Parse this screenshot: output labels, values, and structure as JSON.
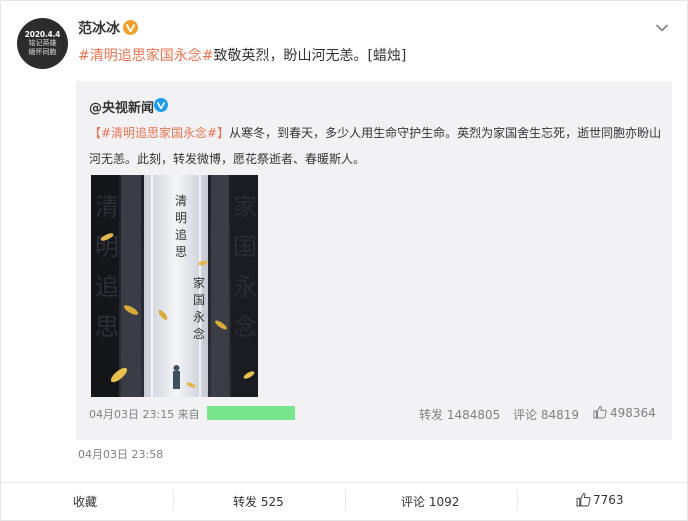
{
  "post": {
    "username": "范冰冰",
    "avatar": {
      "line1": "2020.4.4",
      "line2": "铭记英雄",
      "line3": "缅怀同胞"
    },
    "topic": "#清明追思家国永念#",
    "text": "致敬英烈，盼山河无恙。[蜡烛]",
    "time": "04月03日 23:58"
  },
  "repost": {
    "username": "@央视新闻",
    "topic": "【#清明追思家国永念#】",
    "text": "从寒冬，到春天，多少人用生命守护生命。英烈为家国舍生忘死，逝世同胞亦盼山河无恙。此刻，转发微博，愿花祭逝者、春暖斯人。",
    "poster_line1": "清明追思",
    "poster_line2": "家国永念",
    "time_source": "04月03日 23:15 来自",
    "reposts": "转发 1484805",
    "comments": "评论 84819",
    "likes": "498364"
  },
  "actions": {
    "favorite": "收藏",
    "repost": "转发 525",
    "comment": "评论 1092",
    "like": "7763"
  },
  "colors": {
    "topic": "#eb7350",
    "verified_orange": "#f0a12b",
    "verified_blue": "#1f9cf0",
    "source_redacted": "#79e58d"
  }
}
